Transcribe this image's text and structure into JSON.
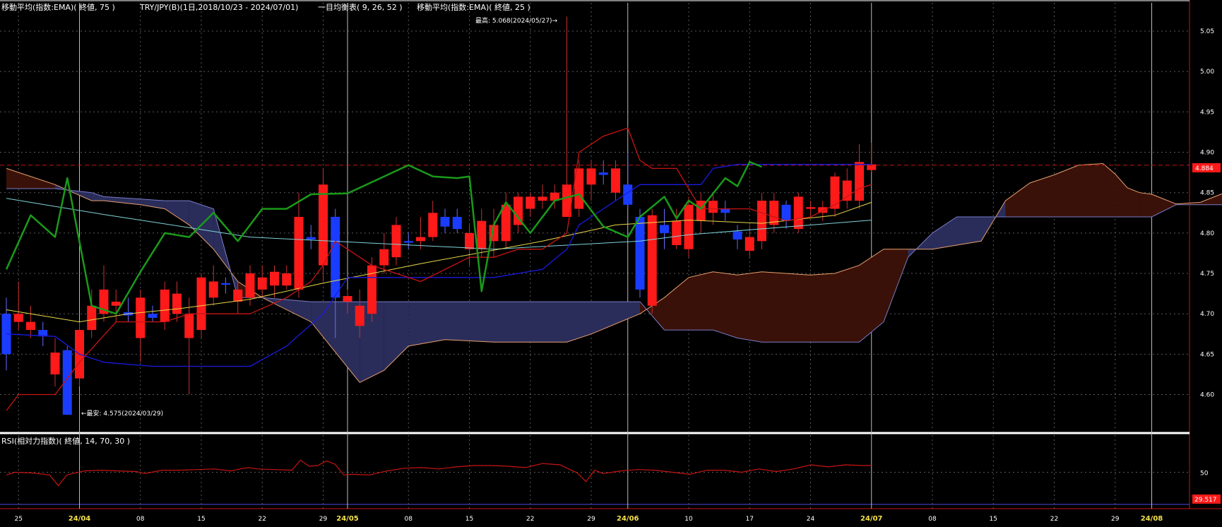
{
  "header": {
    "ema75_label": "移動平均(指数:EMA)( 終値, 75 )",
    "pair_label": "TRY/JPY(B)(1日,2018/10/23 - 2024/07/01)",
    "ichimoku_label": "一目均衡表( 9, 26, 52 )",
    "ema25_label": "移動平均(指数:EMA)( 終値, 25 )"
  },
  "annotations": {
    "high": "最高: 5.068(2024/05/27)→",
    "low": "←最安: 4.575(2024/03/29)"
  },
  "rsi": {
    "label": "RSI(相対力指数)( 終値, 14, 70, 30 )",
    "current_value": "29.517",
    "ticks": [
      "50"
    ]
  },
  "price": {
    "current_value": "4.884",
    "ticks": [
      "5.05",
      "5.00",
      "4.95",
      "4.90",
      "4.85",
      "4.80",
      "4.75",
      "4.70",
      "4.65",
      "4.60"
    ]
  },
  "colors": {
    "background": "#000000",
    "bull_candle": "#ff1a1a",
    "bear_candle": "#1a3cff",
    "ema75": "#7fd3d8",
    "ema25": "#e8d84a",
    "tenkan": "#c81414",
    "kijun": "#1a1ae0",
    "chikou": "#1a9a1a",
    "kumo_bull": "#3a1108",
    "kumo_bear": "#2a2d5a",
    "rsi_line": "#c81414",
    "current_tag": "#ff1a1a"
  },
  "chart_data": {
    "type": "candlestick",
    "y_range": [
      4.555,
      5.085
    ],
    "x_ticks": [
      {
        "label": "25",
        "idx": 1,
        "month": false
      },
      {
        "label": "24/04",
        "idx": 6,
        "month": true
      },
      {
        "label": "08",
        "idx": 11,
        "month": false
      },
      {
        "label": "15",
        "idx": 16,
        "month": false
      },
      {
        "label": "22",
        "idx": 21,
        "month": false
      },
      {
        "label": "29",
        "idx": 26,
        "month": false
      },
      {
        "label": "24/05",
        "idx": 28,
        "month": true
      },
      {
        "label": "08",
        "idx": 33,
        "month": false
      },
      {
        "label": "15",
        "idx": 38,
        "month": false
      },
      {
        "label": "22",
        "idx": 43,
        "month": false
      },
      {
        "label": "29",
        "idx": 48,
        "month": false
      },
      {
        "label": "24/06",
        "idx": 51,
        "month": true
      },
      {
        "label": "10",
        "idx": 56,
        "month": false
      },
      {
        "label": "17",
        "idx": 61,
        "month": false
      },
      {
        "label": "24",
        "idx": 66,
        "month": false
      },
      {
        "label": "24/07",
        "idx": 71,
        "month": true
      },
      {
        "label": "08",
        "idx": 76,
        "month": false
      },
      {
        "label": "15",
        "idx": 81,
        "month": false
      },
      {
        "label": "22",
        "idx": 86,
        "month": false
      },
      {
        "label": "29",
        "idx": 91,
        "month": false
      },
      {
        "label": "24/08",
        "idx": 94,
        "month": true
      }
    ],
    "candles": [
      [
        4.7,
        4.65,
        4.72,
        4.63
      ],
      [
        4.69,
        4.7,
        4.74,
        4.68
      ],
      [
        4.68,
        4.69,
        4.71,
        4.67
      ],
      [
        4.68,
        4.672,
        4.69,
        4.66
      ],
      [
        4.625,
        4.652,
        4.67,
        4.61
      ],
      [
        4.655,
        4.575,
        4.66,
        4.575
      ],
      [
        4.62,
        4.68,
        4.69,
        4.61
      ],
      [
        4.68,
        4.71,
        4.73,
        4.67
      ],
      [
        4.7,
        4.73,
        4.76,
        4.69
      ],
      [
        4.71,
        4.715,
        4.73,
        4.69
      ],
      [
        4.702,
        4.698,
        4.72,
        4.69
      ],
      [
        4.67,
        4.72,
        4.73,
        4.64
      ],
      [
        4.7,
        4.695,
        4.71,
        4.69
      ],
      [
        4.69,
        4.73,
        4.74,
        4.68
      ],
      [
        4.7,
        4.725,
        4.74,
        4.69
      ],
      [
        4.67,
        4.7,
        4.72,
        4.6
      ],
      [
        4.68,
        4.745,
        4.75,
        4.67
      ],
      [
        4.72,
        4.74,
        4.76,
        4.71
      ],
      [
        4.738,
        4.736,
        4.745,
        4.725
      ],
      [
        4.715,
        4.73,
        4.74,
        4.7
      ],
      [
        4.72,
        4.75,
        4.76,
        4.71
      ],
      [
        4.73,
        4.745,
        4.76,
        4.72
      ],
      [
        4.735,
        4.752,
        4.76,
        4.72
      ],
      [
        4.735,
        4.75,
        4.76,
        4.73
      ],
      [
        4.73,
        4.82,
        4.85,
        4.72
      ],
      [
        4.795,
        4.792,
        4.81,
        4.78
      ],
      [
        4.76,
        4.86,
        4.88,
        4.74
      ],
      [
        4.82,
        4.72,
        4.83,
        4.67
      ],
      [
        4.715,
        4.722,
        4.73,
        4.7
      ],
      [
        4.685,
        4.71,
        4.73,
        4.67
      ],
      [
        4.7,
        4.76,
        4.77,
        4.69
      ],
      [
        4.76,
        4.78,
        4.8,
        4.75
      ],
      [
        4.77,
        4.81,
        4.82,
        4.76
      ],
      [
        4.79,
        4.788,
        4.8,
        4.78
      ],
      [
        4.79,
        4.795,
        4.82,
        4.78
      ],
      [
        4.795,
        4.825,
        4.84,
        4.79
      ],
      [
        4.82,
        4.808,
        4.83,
        4.8
      ],
      [
        4.82,
        4.805,
        4.83,
        4.8
      ],
      [
        4.78,
        4.8,
        4.81,
        4.76
      ],
      [
        4.78,
        4.815,
        4.83,
        4.77
      ],
      [
        4.79,
        4.81,
        4.83,
        4.77
      ],
      [
        4.79,
        4.835,
        4.85,
        4.78
      ],
      [
        4.81,
        4.845,
        4.85,
        4.8
      ],
      [
        4.83,
        4.845,
        4.85,
        4.82
      ],
      [
        4.84,
        4.845,
        4.86,
        4.83
      ],
      [
        4.84,
        4.85,
        4.86,
        4.83
      ],
      [
        4.82,
        4.86,
        5.068,
        4.82
      ],
      [
        4.83,
        4.88,
        4.89,
        4.82
      ],
      [
        4.86,
        4.88,
        4.89,
        4.84
      ],
      [
        4.875,
        4.872,
        4.89,
        4.86
      ],
      [
        4.85,
        4.88,
        4.89,
        4.84
      ],
      [
        4.86,
        4.835,
        4.9,
        4.83
      ],
      [
        4.82,
        4.73,
        4.83,
        4.72
      ],
      [
        4.71,
        4.822,
        4.83,
        4.7
      ],
      [
        4.81,
        4.8,
        4.83,
        4.78
      ],
      [
        4.785,
        4.815,
        4.83,
        4.78
      ],
      [
        4.78,
        4.835,
        4.845,
        4.77
      ],
      [
        4.815,
        4.84,
        4.85,
        4.8
      ],
      [
        4.825,
        4.84,
        4.85,
        4.81
      ],
      [
        4.83,
        4.825,
        4.84,
        4.815
      ],
      [
        4.802,
        4.792,
        4.81,
        4.78
      ],
      [
        4.778,
        4.795,
        4.81,
        4.77
      ],
      [
        4.79,
        4.84,
        4.85,
        4.78
      ],
      [
        4.81,
        4.84,
        4.85,
        4.8
      ],
      [
        4.835,
        4.815,
        4.84,
        4.805
      ],
      [
        4.805,
        4.845,
        4.85,
        4.8
      ],
      [
        4.83,
        4.832,
        4.84,
        4.82
      ],
      [
        4.825,
        4.832,
        4.84,
        4.815
      ],
      [
        4.83,
        4.87,
        4.875,
        4.82
      ],
      [
        4.84,
        4.865,
        4.88,
        4.83
      ],
      [
        4.84,
        4.888,
        4.91,
        4.83
      ],
      [
        4.878,
        4.885,
        4.912,
        4.875
      ]
    ],
    "ema75": [
      [
        0,
        4.843
      ],
      [
        8,
        4.823
      ],
      [
        20,
        4.795
      ],
      [
        40,
        4.78
      ],
      [
        52,
        4.79
      ],
      [
        56,
        4.798
      ],
      [
        71,
        4.816
      ]
    ],
    "ema25": [
      [
        0,
        4.705
      ],
      [
        6,
        4.69
      ],
      [
        10,
        4.7
      ],
      [
        14,
        4.706
      ],
      [
        20,
        4.718
      ],
      [
        26,
        4.738
      ],
      [
        34,
        4.762
      ],
      [
        44,
        4.79
      ],
      [
        50,
        4.81
      ],
      [
        56,
        4.816
      ],
      [
        62,
        4.812
      ],
      [
        68,
        4.822
      ],
      [
        71,
        4.838
      ]
    ],
    "tenkan": [
      [
        0,
        4.58
      ],
      [
        1,
        4.6
      ],
      [
        4,
        4.6
      ],
      [
        6,
        4.64
      ],
      [
        9,
        4.69
      ],
      [
        13,
        4.69
      ],
      [
        15,
        4.7
      ],
      [
        17,
        4.7
      ],
      [
        20,
        4.7
      ],
      [
        23,
        4.72
      ],
      [
        25,
        4.74
      ],
      [
        26,
        4.76
      ],
      [
        27,
        4.79
      ],
      [
        28,
        4.78
      ],
      [
        30,
        4.76
      ],
      [
        34,
        4.74
      ],
      [
        38,
        4.77
      ],
      [
        40,
        4.77
      ],
      [
        42,
        4.78
      ],
      [
        44,
        4.78
      ],
      [
        46,
        4.8
      ],
      [
        47,
        4.9
      ],
      [
        49,
        4.92
      ],
      [
        51,
        4.93
      ],
      [
        52,
        4.89
      ],
      [
        53,
        4.88
      ],
      [
        55,
        4.88
      ],
      [
        57,
        4.83
      ],
      [
        59,
        4.83
      ],
      [
        61,
        4.83
      ],
      [
        64,
        4.815
      ],
      [
        66,
        4.82
      ],
      [
        68,
        4.835
      ],
      [
        70,
        4.855
      ],
      [
        71,
        4.86
      ]
    ],
    "kijun": [
      [
        0,
        4.675
      ],
      [
        4,
        4.672
      ],
      [
        6,
        4.65
      ],
      [
        8,
        4.64
      ],
      [
        12,
        4.635
      ],
      [
        20,
        4.635
      ],
      [
        23,
        4.66
      ],
      [
        26,
        4.7
      ],
      [
        28,
        4.745
      ],
      [
        34,
        4.745
      ],
      [
        40,
        4.745
      ],
      [
        44,
        4.755
      ],
      [
        46,
        4.78
      ],
      [
        47,
        4.81
      ],
      [
        52,
        4.86
      ],
      [
        57,
        4.86
      ],
      [
        58,
        4.88
      ],
      [
        60,
        4.885
      ],
      [
        65,
        4.885
      ],
      [
        71,
        4.885
      ]
    ],
    "chikou": [
      [
        0,
        4.755
      ],
      [
        2,
        4.822
      ],
      [
        4,
        4.795
      ],
      [
        5,
        4.868
      ],
      [
        7,
        4.71
      ],
      [
        9,
        4.7
      ],
      [
        11,
        4.752
      ],
      [
        13,
        4.8
      ],
      [
        15,
        4.795
      ],
      [
        17,
        4.825
      ],
      [
        19,
        4.79
      ],
      [
        21,
        4.83
      ],
      [
        23,
        4.83
      ],
      [
        25,
        4.848
      ],
      [
        28,
        4.849
      ],
      [
        31,
        4.87
      ],
      [
        33,
        4.884
      ],
      [
        35,
        4.87
      ],
      [
        37,
        4.868
      ],
      [
        38,
        4.87
      ],
      [
        39,
        4.728
      ],
      [
        40,
        4.81
      ],
      [
        41,
        4.838
      ],
      [
        43,
        4.8
      ],
      [
        45,
        4.84
      ],
      [
        47,
        4.848
      ],
      [
        49,
        4.808
      ],
      [
        51,
        4.795
      ],
      [
        52,
        4.82
      ],
      [
        54,
        4.845
      ],
      [
        55,
        4.818
      ],
      [
        56,
        4.84
      ],
      [
        57,
        4.83
      ],
      [
        59,
        4.868
      ],
      [
        60,
        4.858
      ],
      [
        61,
        4.888
      ],
      [
        62,
        4.882
      ]
    ],
    "kumo_a": [
      [
        0,
        4.88
      ],
      [
        4,
        4.86
      ],
      [
        7,
        4.84
      ],
      [
        8,
        4.84
      ],
      [
        11,
        4.835
      ],
      [
        13,
        4.83
      ],
      [
        15,
        4.81
      ],
      [
        17,
        4.78
      ],
      [
        19,
        4.74
      ],
      [
        21,
        4.72
      ],
      [
        25,
        4.69
      ],
      [
        29,
        4.615
      ],
      [
        31,
        4.63
      ],
      [
        33,
        4.66
      ],
      [
        36,
        4.668
      ],
      [
        40,
        4.665
      ],
      [
        46,
        4.665
      ],
      [
        48,
        4.675
      ],
      [
        52,
        4.7
      ],
      [
        54,
        4.72
      ],
      [
        56,
        4.745
      ],
      [
        58,
        4.752
      ],
      [
        60,
        4.748
      ],
      [
        62,
        4.752
      ],
      [
        66,
        4.748
      ],
      [
        68,
        4.75
      ],
      [
        70,
        4.76
      ],
      [
        72,
        4.78
      ],
      [
        74,
        4.78
      ],
      [
        76,
        4.78
      ],
      [
        78,
        4.785
      ],
      [
        80,
        4.79
      ],
      [
        82,
        4.84
      ],
      [
        84,
        4.862
      ],
      [
        86,
        4.872
      ],
      [
        88,
        4.884
      ],
      [
        90,
        4.886
      ],
      [
        91,
        4.873
      ],
      [
        92,
        4.856
      ],
      [
        93,
        4.85
      ],
      [
        94,
        4.848
      ],
      [
        96,
        4.836
      ],
      [
        98,
        4.838
      ],
      [
        100,
        4.85
      ],
      [
        102,
        4.836
      ],
      [
        104,
        4.836
      ],
      [
        106,
        4.852
      ],
      [
        108,
        4.852
      ],
      [
        110,
        4.87
      ],
      [
        111,
        4.865
      ]
    ],
    "kumo_b": [
      [
        0,
        4.855
      ],
      [
        4,
        4.855
      ],
      [
        7,
        4.85
      ],
      [
        8,
        4.845
      ],
      [
        11,
        4.842
      ],
      [
        13,
        4.84
      ],
      [
        15,
        4.84
      ],
      [
        17,
        4.83
      ],
      [
        19,
        4.72
      ],
      [
        21,
        4.72
      ],
      [
        25,
        4.715
      ],
      [
        29,
        4.715
      ],
      [
        31,
        4.715
      ],
      [
        33,
        4.715
      ],
      [
        36,
        4.715
      ],
      [
        40,
        4.715
      ],
      [
        46,
        4.715
      ],
      [
        48,
        4.715
      ],
      [
        52,
        4.715
      ],
      [
        54,
        4.68
      ],
      [
        56,
        4.68
      ],
      [
        58,
        4.68
      ],
      [
        60,
        4.67
      ],
      [
        62,
        4.665
      ],
      [
        66,
        4.665
      ],
      [
        68,
        4.665
      ],
      [
        70,
        4.665
      ],
      [
        72,
        4.69
      ],
      [
        74,
        4.77
      ],
      [
        76,
        4.8
      ],
      [
        78,
        4.82
      ],
      [
        80,
        4.82
      ],
      [
        82,
        4.82
      ],
      [
        84,
        4.82
      ],
      [
        86,
        4.82
      ],
      [
        88,
        4.82
      ],
      [
        90,
        4.82
      ],
      [
        91,
        4.82
      ],
      [
        92,
        4.82
      ],
      [
        93,
        4.82
      ],
      [
        94,
        4.82
      ],
      [
        96,
        4.835
      ],
      [
        98,
        4.835
      ],
      [
        100,
        4.835
      ],
      [
        102,
        4.835
      ],
      [
        104,
        4.835
      ],
      [
        106,
        4.835
      ],
      [
        108,
        4.845
      ],
      [
        110,
        4.846
      ],
      [
        111,
        4.846
      ]
    ],
    "rsi": [
      [
        0,
        46
      ],
      [
        1,
        50
      ],
      [
        3,
        49
      ],
      [
        5,
        46
      ],
      [
        6,
        30
      ],
      [
        7,
        46
      ],
      [
        9,
        52
      ],
      [
        11,
        53
      ],
      [
        13,
        52
      ],
      [
        15,
        51
      ],
      [
        16,
        48
      ],
      [
        18,
        53
      ],
      [
        20,
        53
      ],
      [
        22,
        54
      ],
      [
        24,
        55
      ],
      [
        26,
        52
      ],
      [
        27,
        55
      ],
      [
        28,
        57
      ],
      [
        29,
        55
      ],
      [
        31,
        54
      ],
      [
        33,
        53
      ],
      [
        34,
        68
      ],
      [
        35,
        59
      ],
      [
        36,
        60
      ],
      [
        37,
        67
      ],
      [
        38,
        62
      ],
      [
        39,
        46
      ],
      [
        40,
        47
      ],
      [
        42,
        46
      ],
      [
        44,
        52
      ],
      [
        46,
        56
      ],
      [
        48,
        57
      ],
      [
        50,
        55
      ],
      [
        52,
        58
      ],
      [
        54,
        60
      ],
      [
        56,
        60
      ],
      [
        58,
        59
      ],
      [
        60,
        57
      ],
      [
        62,
        63
      ],
      [
        64,
        61
      ],
      [
        65,
        55
      ],
      [
        66,
        49
      ],
      [
        67,
        36
      ],
      [
        68,
        53
      ],
      [
        69,
        48
      ],
      [
        71,
        52
      ],
      [
        73,
        54
      ],
      [
        75,
        53
      ],
      [
        77,
        50
      ],
      [
        79,
        47
      ],
      [
        81,
        53
      ],
      [
        83,
        53
      ],
      [
        85,
        50
      ],
      [
        87,
        55
      ],
      [
        89,
        51
      ],
      [
        91,
        55
      ],
      [
        93,
        61
      ],
      [
        95,
        58
      ],
      [
        97,
        61
      ],
      [
        99,
        60
      ],
      [
        100,
        60
      ]
    ]
  }
}
